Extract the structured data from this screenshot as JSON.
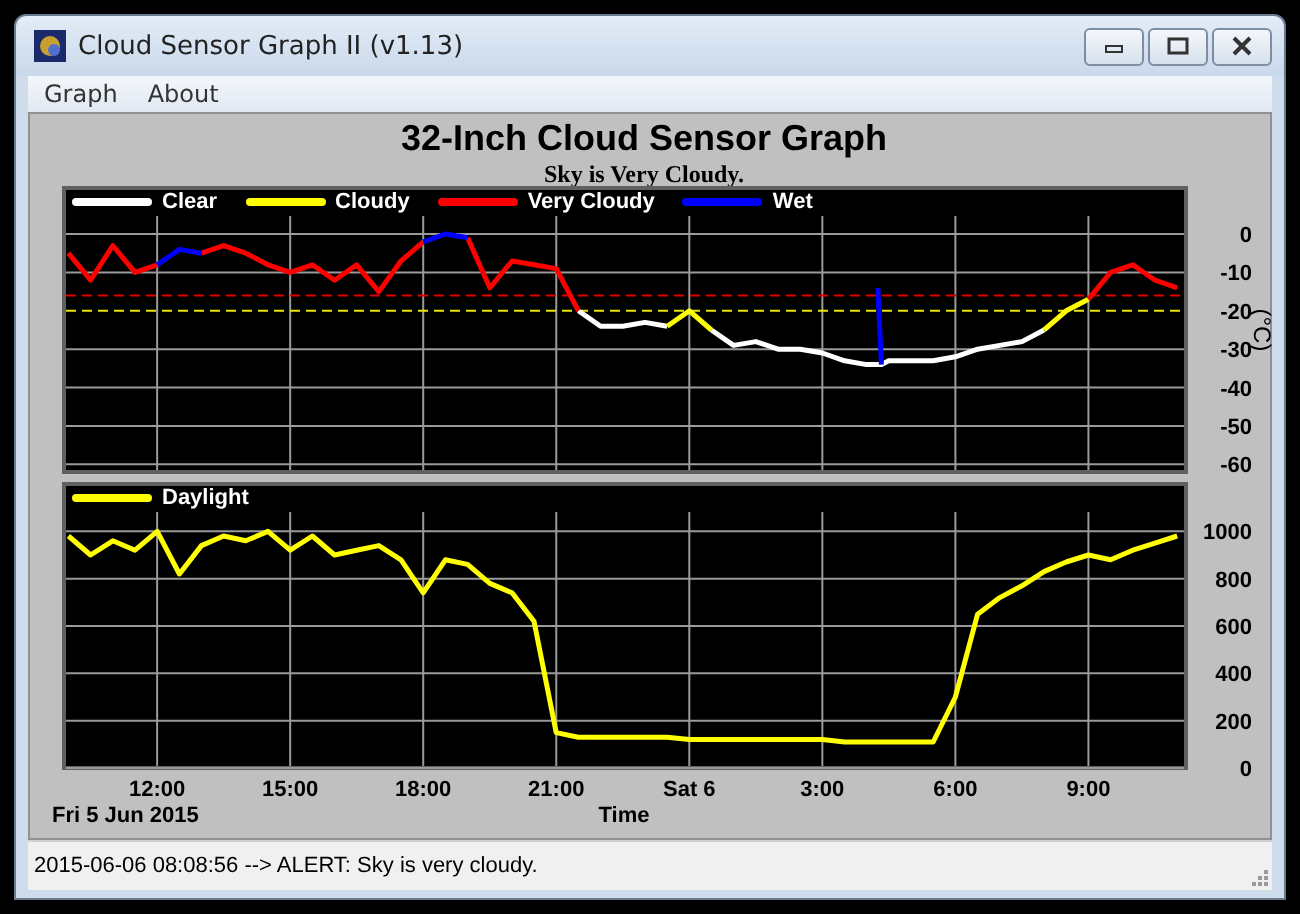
{
  "window": {
    "title": "Cloud Sensor Graph II (v1.13)"
  },
  "menu": [
    {
      "label": "Graph"
    },
    {
      "label": "About"
    }
  ],
  "graph": {
    "title": "32-Inch Cloud Sensor Graph",
    "status": "Sky is Very Cloudy.",
    "sky_chart": {
      "chart_data": {
        "type": "line",
        "ylabel": "(°C)",
        "grid": true,
        "xlim": [
          "2015-06-05T09:54",
          "2015-06-06T11:12"
        ],
        "ylim": [
          -62,
          12
        ],
        "x": [
          "2015-06-05T10:00",
          "2015-06-05T10:30",
          "2015-06-05T11:00",
          "2015-06-05T11:30",
          "2015-06-05T12:00",
          "2015-06-05T12:30",
          "2015-06-05T13:00",
          "2015-06-05T13:30",
          "2015-06-05T14:00",
          "2015-06-05T14:30",
          "2015-06-05T15:00",
          "2015-06-05T15:30",
          "2015-06-05T16:00",
          "2015-06-05T16:30",
          "2015-06-05T17:00",
          "2015-06-05T17:30",
          "2015-06-05T18:00",
          "2015-06-05T18:30",
          "2015-06-05T19:00",
          "2015-06-05T19:30",
          "2015-06-05T20:00",
          "2015-06-05T20:30",
          "2015-06-05T21:00",
          "2015-06-05T21:30",
          "2015-06-05T22:00",
          "2015-06-05T22:30",
          "2015-06-05T23:00",
          "2015-06-05T23:30",
          "2015-06-06T00:00",
          "2015-06-06T00:30",
          "2015-06-06T01:00",
          "2015-06-06T01:30",
          "2015-06-06T02:00",
          "2015-06-06T02:30",
          "2015-06-06T03:00",
          "2015-06-06T03:30",
          "2015-06-06T04:00",
          "2015-06-06T04:15",
          "2015-06-06T04:20",
          "2015-06-06T04:30",
          "2015-06-06T05:00",
          "2015-06-06T05:30",
          "2015-06-06T06:00",
          "2015-06-06T06:30",
          "2015-06-06T07:00",
          "2015-06-06T07:30",
          "2015-06-06T08:00",
          "2015-06-06T08:30",
          "2015-06-06T09:00",
          "2015-06-06T09:30",
          "2015-06-06T10:00",
          "2015-06-06T10:30",
          "2015-06-06T11:00"
        ],
        "series": [
          {
            "name": "Clear",
            "color": "#ffffff",
            "values": [
              null,
              null,
              null,
              null,
              null,
              null,
              null,
              null,
              null,
              null,
              null,
              null,
              null,
              null,
              null,
              null,
              null,
              null,
              null,
              null,
              null,
              null,
              null,
              -20,
              -24,
              -24,
              -23,
              -24,
              null,
              -25,
              -29,
              -28,
              -30,
              -30,
              -31,
              -33,
              -34,
              -34,
              -34,
              -33,
              -33,
              -33,
              -32,
              -30,
              -29,
              -28,
              -25,
              null,
              null,
              null,
              null,
              null,
              null
            ]
          },
          {
            "name": "Cloudy",
            "color": "#ffff00",
            "values": [
              null,
              null,
              null,
              null,
              null,
              null,
              null,
              null,
              null,
              null,
              null,
              null,
              null,
              null,
              null,
              null,
              null,
              null,
              null,
              null,
              null,
              null,
              null,
              null,
              null,
              null,
              null,
              -24,
              -20,
              -25,
              null,
              null,
              null,
              null,
              null,
              null,
              null,
              null,
              null,
              null,
              null,
              null,
              null,
              null,
              null,
              null,
              -25,
              -20,
              -17,
              null,
              null,
              null,
              null
            ]
          },
          {
            "name": "Very Cloudy",
            "color": "#ff0000",
            "values": [
              -5,
              -12,
              -3,
              -10,
              -8,
              null,
              -5,
              -3,
              -5,
              -8,
              -10,
              -8,
              -12,
              -8,
              -15,
              -7,
              -2,
              null,
              -1,
              -14,
              -7,
              -8,
              -9,
              -20,
              null,
              null,
              null,
              null,
              null,
              null,
              null,
              null,
              null,
              null,
              null,
              null,
              null,
              null,
              null,
              null,
              null,
              null,
              null,
              null,
              null,
              null,
              null,
              null,
              -17,
              -10,
              -8,
              -12,
              -14
            ]
          },
          {
            "name": "Wet",
            "color": "#0000ff",
            "values": [
              null,
              null,
              null,
              null,
              -8,
              -4,
              -5,
              null,
              null,
              null,
              null,
              null,
              null,
              null,
              null,
              null,
              -2,
              0,
              -1,
              null,
              null,
              null,
              null,
              null,
              null,
              null,
              null,
              null,
              null,
              null,
              null,
              null,
              null,
              null,
              null,
              null,
              null,
              -14,
              -34,
              null,
              null,
              null,
              null,
              null,
              null,
              null,
              null,
              null,
              null,
              null,
              null,
              null,
              null
            ]
          }
        ],
        "yticks": [
          {
            "value": 0,
            "label": "0"
          },
          {
            "value": -10,
            "label": "-10"
          },
          {
            "value": -20,
            "label": "-20"
          },
          {
            "value": -30,
            "label": "-30"
          },
          {
            "value": -40,
            "label": "-40"
          },
          {
            "value": -50,
            "label": "-50"
          },
          {
            "value": -60,
            "label": "-60"
          }
        ],
        "legend": "upper left",
        "ref_lines": [
          {
            "axis": "y",
            "value": -16,
            "color": "#e00000"
          },
          {
            "axis": "y",
            "value": -20,
            "color": "#e8e800"
          }
        ]
      }
    },
    "daylight_chart": {
      "chart_data": {
        "type": "line",
        "xlabel": "Time",
        "grid": true,
        "legend": "upper left",
        "xlim": [
          "2015-06-05T09:54",
          "2015-06-06T11:12"
        ],
        "ylim": [
          0,
          1200
        ],
        "x": [
          "2015-06-05T10:00",
          "2015-06-05T10:30",
          "2015-06-05T11:00",
          "2015-06-05T11:30",
          "2015-06-05T12:00",
          "2015-06-05T12:30",
          "2015-06-05T13:00",
          "2015-06-05T13:30",
          "2015-06-05T14:00",
          "2015-06-05T14:30",
          "2015-06-05T15:00",
          "2015-06-05T15:30",
          "2015-06-05T16:00",
          "2015-06-05T16:30",
          "2015-06-05T17:00",
          "2015-06-05T17:30",
          "2015-06-05T18:00",
          "2015-06-05T18:30",
          "2015-06-05T19:00",
          "2015-06-05T19:30",
          "2015-06-05T20:00",
          "2015-06-05T20:30",
          "2015-06-05T21:00",
          "2015-06-05T21:30",
          "2015-06-05T22:00",
          "2015-06-05T22:30",
          "2015-06-05T23:00",
          "2015-06-05T23:30",
          "2015-06-06T00:00",
          "2015-06-06T00:30",
          "2015-06-06T01:00",
          "2015-06-06T01:30",
          "2015-06-06T02:00",
          "2015-06-06T02:30",
          "2015-06-06T03:00",
          "2015-06-06T03:30",
          "2015-06-06T04:00",
          "2015-06-06T04:30",
          "2015-06-06T05:00",
          "2015-06-06T05:30",
          "2015-06-06T06:00",
          "2015-06-06T06:30",
          "2015-06-06T07:00",
          "2015-06-06T07:30",
          "2015-06-06T08:00",
          "2015-06-06T08:30",
          "2015-06-06T09:00",
          "2015-06-06T09:30",
          "2015-06-06T10:00",
          "2015-06-06T10:30",
          "2015-06-06T11:00"
        ],
        "series": [
          {
            "name": "Daylight",
            "color": "#ffff00",
            "values": [
              980,
              900,
              960,
              920,
              1000,
              820,
              940,
              980,
              960,
              1000,
              920,
              980,
              900,
              920,
              940,
              880,
              740,
              880,
              860,
              780,
              740,
              620,
              150,
              130,
              130,
              130,
              130,
              130,
              120,
              120,
              120,
              120,
              120,
              120,
              120,
              110,
              110,
              110,
              110,
              110,
              300,
              650,
              720,
              770,
              830,
              870,
              900,
              880,
              920,
              950,
              980
            ]
          }
        ],
        "xticks": [
          {
            "value": "2015-06-05T12:00",
            "label": "12:00"
          },
          {
            "value": "2015-06-05T15:00",
            "label": "15:00"
          },
          {
            "value": "2015-06-05T18:00",
            "label": "18:00"
          },
          {
            "value": "2015-06-05T21:00",
            "label": "21:00"
          },
          {
            "value": "2015-06-06T00:00",
            "label": "Sat 6"
          },
          {
            "value": "2015-06-06T03:00",
            "label": "3:00"
          },
          {
            "value": "2015-06-06T06:00",
            "label": "6:00"
          },
          {
            "value": "2015-06-06T09:00",
            "label": "9:00"
          }
        ],
        "yticks": [
          {
            "value": 0,
            "label": "0"
          },
          {
            "value": 200,
            "label": "200"
          },
          {
            "value": 400,
            "label": "400"
          },
          {
            "value": 600,
            "label": "600"
          },
          {
            "value": 800,
            "label": "800"
          },
          {
            "value": 1000,
            "label": "1000"
          }
        ]
      }
    },
    "date_label": "Fri 5 Jun 2015"
  },
  "status_bar": {
    "text": "2015-06-06 08:08:56 --> ALERT: Sky is very cloudy."
  }
}
